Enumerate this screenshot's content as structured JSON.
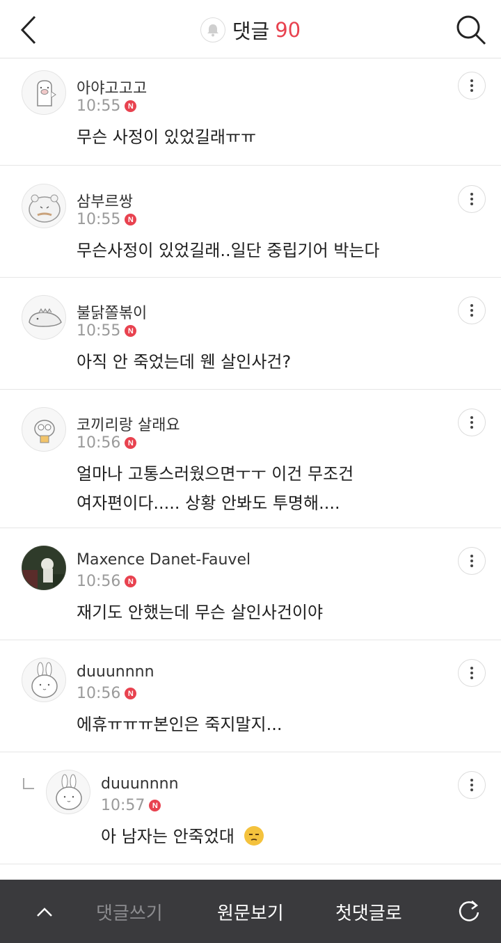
{
  "header": {
    "title": "댓글",
    "count": "90"
  },
  "comments": [
    {
      "nick": "아야고고고",
      "time": "10:55",
      "badge": "N",
      "lines": [
        "무슨 사정이 있었길래ㅠㅠ"
      ]
    },
    {
      "nick": "삼부르쌍",
      "time": "10:55",
      "badge": "N",
      "lines": [
        "무슨사정이 있었길래..일단 중립기어 박는다"
      ]
    },
    {
      "nick": "불닭쫄볶이",
      "time": "10:55",
      "badge": "N",
      "lines": [
        "아직 안 죽었는데 웬 살인사건?"
      ]
    },
    {
      "nick": "코끼리랑 살래요",
      "time": "10:56",
      "badge": "N",
      "lines": [
        "얼마나 고통스러웠으면ㅜㅜ 이건 무조건",
        "여자편이다..... 상황 안봐도 투명해...."
      ]
    },
    {
      "nick": "Maxence Danet-Fauvel",
      "time": "10:56",
      "badge": "N",
      "lines": [
        "재기도 안했는데 무슨 살인사건이야"
      ]
    },
    {
      "nick": "duuunnnn",
      "time": "10:56",
      "badge": "N",
      "lines": [
        "에휴ㅠㅠㅠ본인은 죽지말지..."
      ]
    },
    {
      "nick": "duuunnnn",
      "time": "10:57",
      "badge": "N",
      "lines": [
        "아 남자는 안죽었대"
      ],
      "emoji": "unamused-face-icon",
      "is_reply": true
    }
  ],
  "bottombar": {
    "write": "댓글쓰기",
    "origin": "원문보기",
    "first": "첫댓글로"
  },
  "colors": {
    "accent": "#e8424f",
    "bar": "#3a3a3d"
  }
}
